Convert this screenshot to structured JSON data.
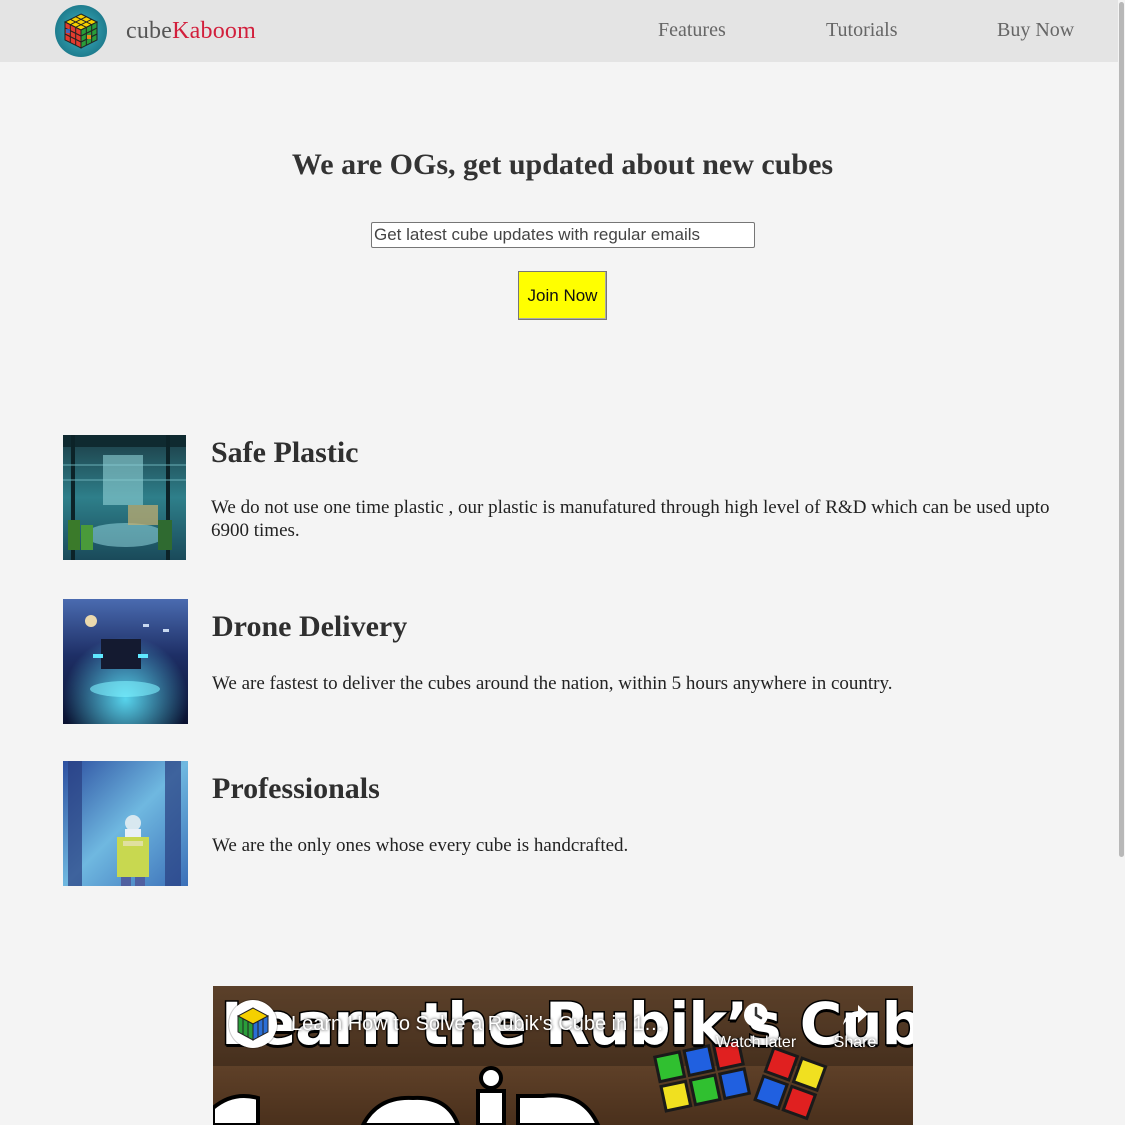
{
  "brand": {
    "name_prefix": "cube",
    "name_accent": "Kaboom",
    "accent_color": "#d21f3c"
  },
  "nav": {
    "features": "Features",
    "tutorials": "Tutorials",
    "buy_now": "Buy Now"
  },
  "signup": {
    "heading": "We are OGs, get updated about new cubes",
    "input_placeholder": "Get latest cube updates with regular emails",
    "input_value": "",
    "button_label": "Join Now",
    "button_color": "#ffff00"
  },
  "features": [
    {
      "title": "Safe Plastic",
      "text": "We do not use one time plastic , our plastic is manufatured through high level of R&D which can be used upto 6900 times.",
      "image_icon": "factory-image"
    },
    {
      "title": "Drone Delivery",
      "text": "We are fastest to deliver the cubes around the nation, within 5 hours anywhere in country.",
      "image_icon": "drone-image"
    },
    {
      "title": "Professionals",
      "text": "We are the only ones whose every cube is handcrafted.",
      "image_icon": "worker-image"
    }
  ],
  "video": {
    "title": "Learn How to Solve a Rubik's Cube in 1…",
    "thumbnail_text": "Learn the Rubik’s Cube",
    "watch_later": "Watch later",
    "share": "Share"
  }
}
